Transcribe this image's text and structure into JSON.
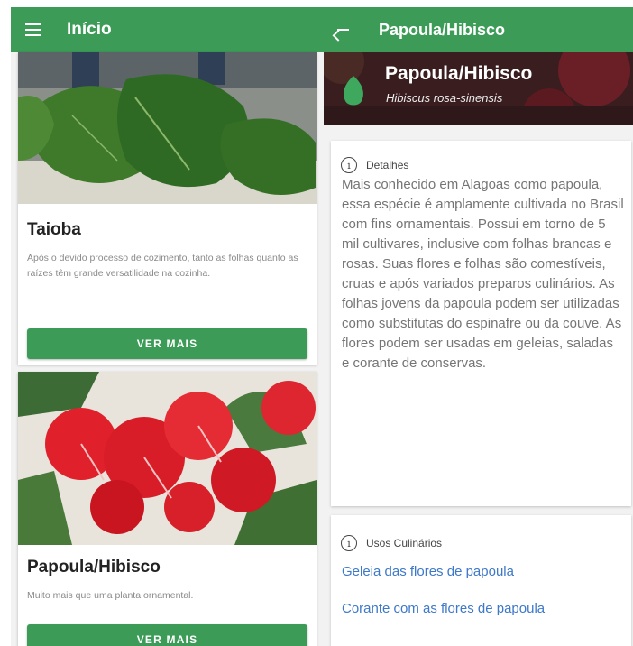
{
  "list_screen": {
    "title": "Início",
    "cards": [
      {
        "title": "Taioba",
        "description": "Após o devido processo de cozimento, tanto as folhas quanto as raízes têm grande versatilidade na cozinha.",
        "button_label": "VER MAIS"
      },
      {
        "title": "Papoula/Hibisco",
        "description": "Muito mais que uma planta ornamental.",
        "button_label": "VER MAIS"
      }
    ]
  },
  "detail_screen": {
    "title": "Papoula/Hibisco",
    "plant_name": "Papoula/Hibisco",
    "scientific_name": "Hibiscus rosa-sinensis",
    "details": {
      "label": "Detalhes",
      "text": "Mais conhecido em Alagoas como papoula, essa espécie é amplamente cultivada no Brasil com fins ornamentais. Possui em torno de 5 mil cultivares, inclusive com folhas brancas e rosas. Suas flores e folhas são comestíveis, cruas e após variados preparos culinários. As folhas jovens da papoula podem ser utilizadas como substitutas do espinafre ou da couve. As flores podem ser usadas em geleias, saladas e corante de conservas."
    },
    "uses": {
      "label": "Usos Culinários",
      "links": [
        "Geleia das flores de papoula",
        "Corante com as flores de papoula"
      ]
    }
  },
  "colors": {
    "primary": "#3b9b57",
    "link": "#3d78c9"
  },
  "icons": {
    "menu": "menu-icon",
    "back": "back-arrow-icon",
    "leaf": "leaf-icon",
    "info": "info-icon"
  }
}
